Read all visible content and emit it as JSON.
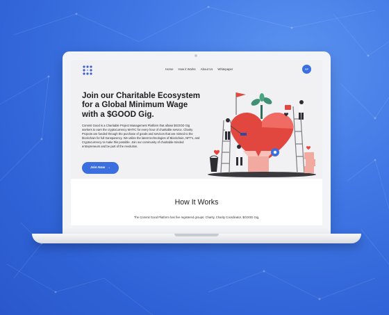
{
  "nav": {
    "avatar_initials": "SP",
    "links": [
      "Home",
      "How it Works",
      "About Us",
      "Whitepaper"
    ]
  },
  "hero": {
    "headline_lines": [
      "Join our Charitable Ecosystem",
      "for a Global Minimum Wage",
      "with a $GOOD Gig."
    ],
    "paragraph": "Commit Good is a Charitable Project Management Platform that allows $GOOD Gig workers to earn the cryptocurrency MATIC for every hour of charitable service. Charity Projects are funded through the purchase of goods and services that are minted to the blockchain for full transparency. We utilize the latest technologies of Blockchain, NFT's, and Cryptocurrency to make this possible. Join our community of charitable-minded entrepreneurs and be part of the revolution.",
    "join_button": "Join Now",
    "join_arrow": "→"
  },
  "how_it_works": {
    "title": "How It Works",
    "text": "The Commit Good Platform has five registered groups: Charity, Charity Coordinator, $GOOD Gig,"
  },
  "colors": {
    "background": "#3f76e4",
    "accent": "#3b6fe0",
    "hero_bg": "#f1f0f3",
    "heart_red": "#e2473f"
  },
  "icons": {
    "logo": "dot-grid-logo-icon",
    "arrow": "arrow-right-icon",
    "illustration": "charity-heart-volunteers-illustration"
  }
}
